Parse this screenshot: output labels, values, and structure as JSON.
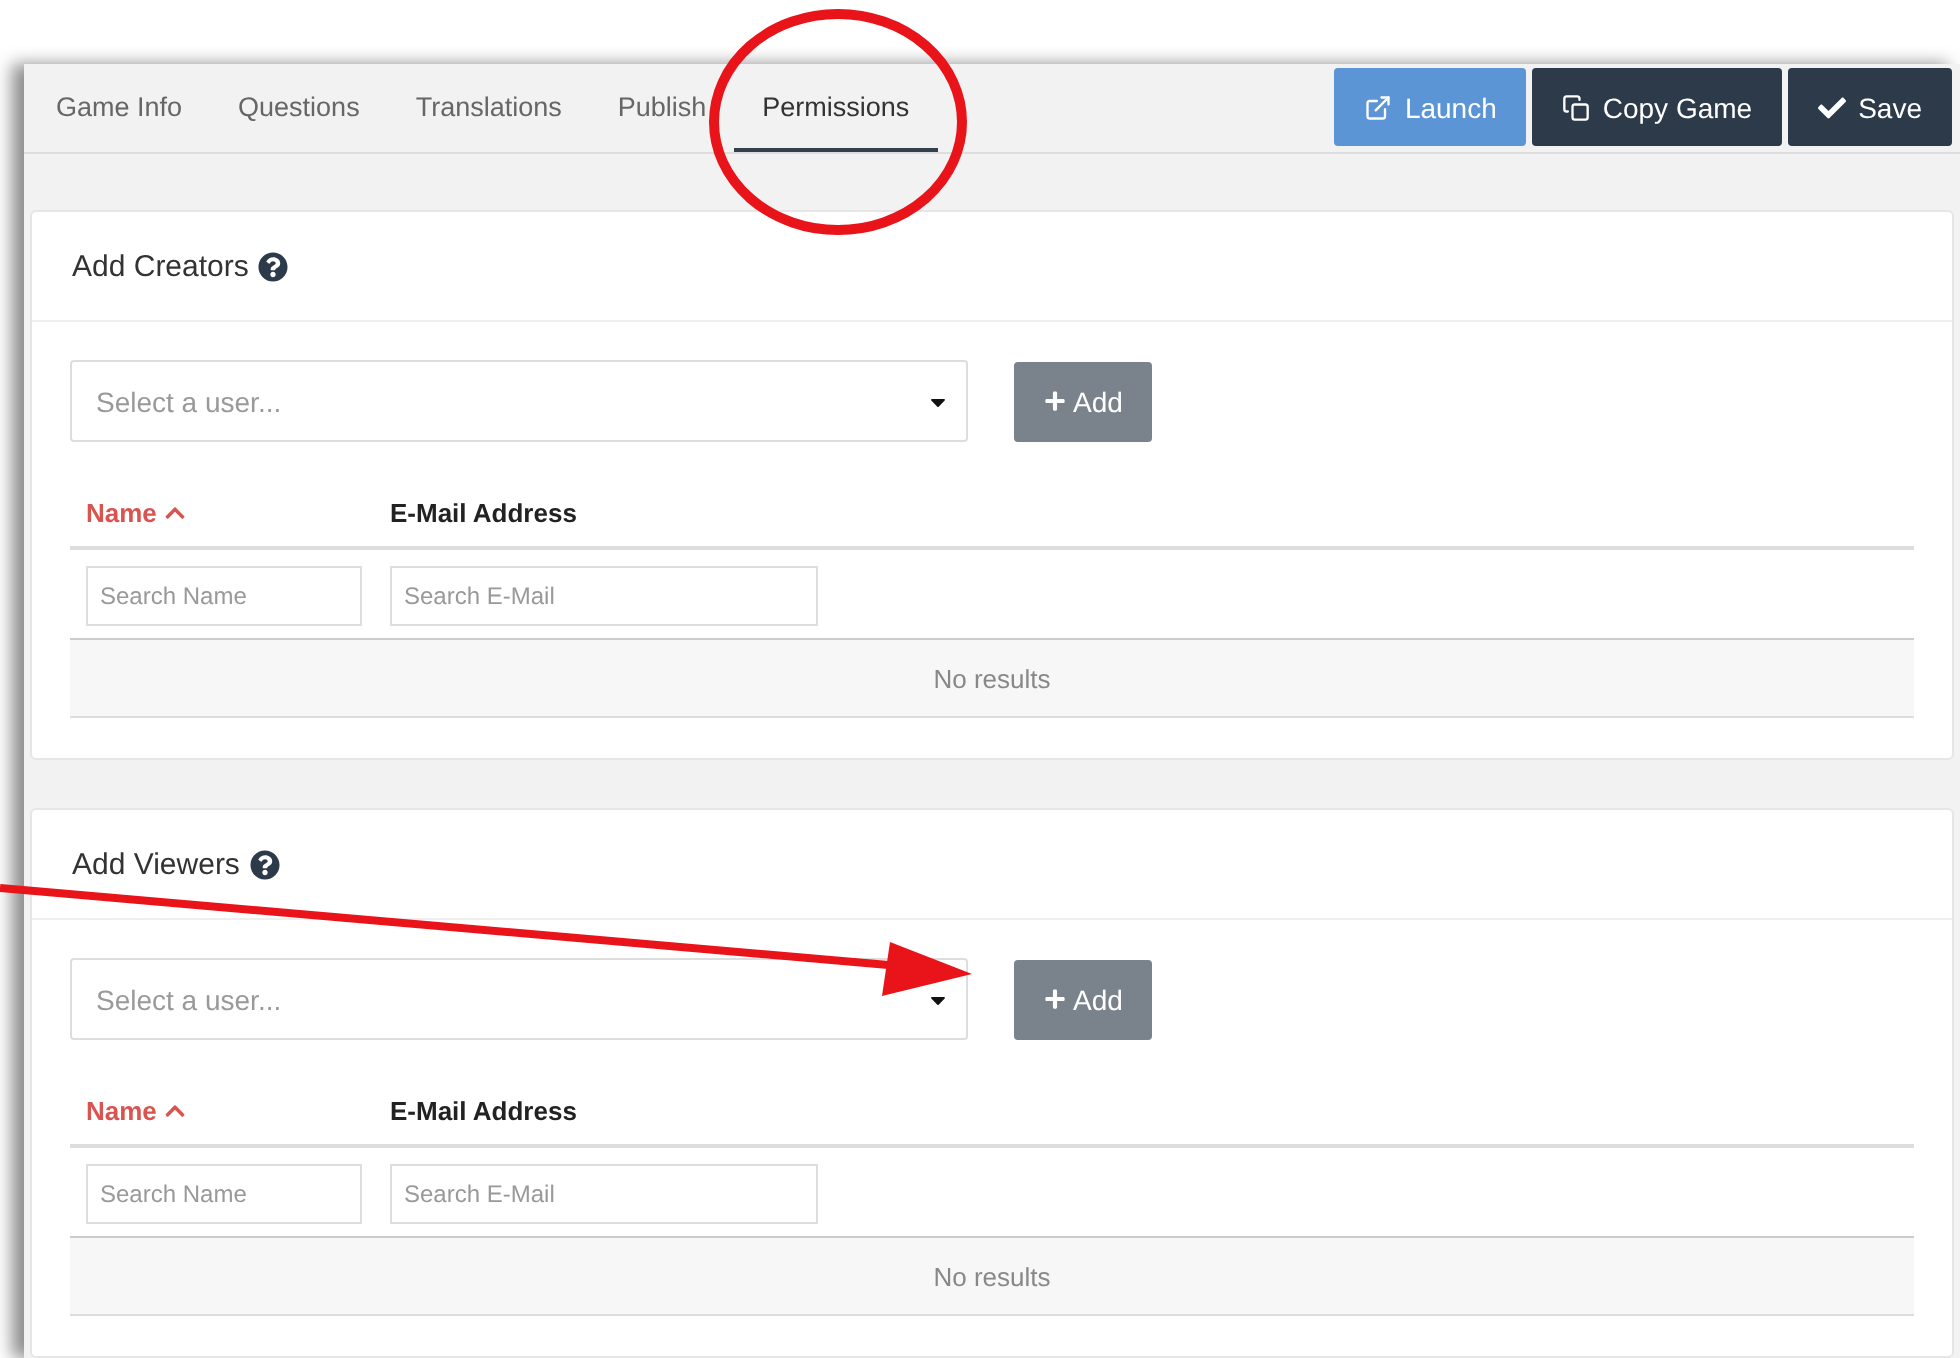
{
  "tabs": [
    {
      "label": "Game Info",
      "selected": false
    },
    {
      "label": "Questions",
      "selected": false
    },
    {
      "label": "Translations",
      "selected": false
    },
    {
      "label": "Publish",
      "selected": false
    },
    {
      "label": "Permissions",
      "selected": true
    }
  ],
  "actions": [
    {
      "label": "Launch",
      "kind": "launch"
    },
    {
      "label": "Copy Game",
      "kind": "copy"
    },
    {
      "label": "Save",
      "kind": "save"
    }
  ],
  "sections": [
    {
      "title": "Add Creators",
      "select": {
        "placeholder": "Select a user..."
      },
      "add_button": "Add",
      "columns": [
        {
          "label": "Name",
          "sorted": true
        },
        {
          "label": "E-Mail Address",
          "sorted": false
        }
      ],
      "filters": [
        {
          "placeholder": "Search Name"
        },
        {
          "placeholder": "Search E-Mail"
        }
      ],
      "empty": "No results"
    },
    {
      "title": "Add Viewers",
      "select": {
        "placeholder": "Select a user..."
      },
      "add_button": "Add",
      "columns": [
        {
          "label": "Name",
          "sorted": true
        },
        {
          "label": "E-Mail Address",
          "sorted": false
        }
      ],
      "filters": [
        {
          "placeholder": "Search Name"
        },
        {
          "placeholder": "Search E-Mail"
        }
      ],
      "empty": "No results"
    }
  ]
}
